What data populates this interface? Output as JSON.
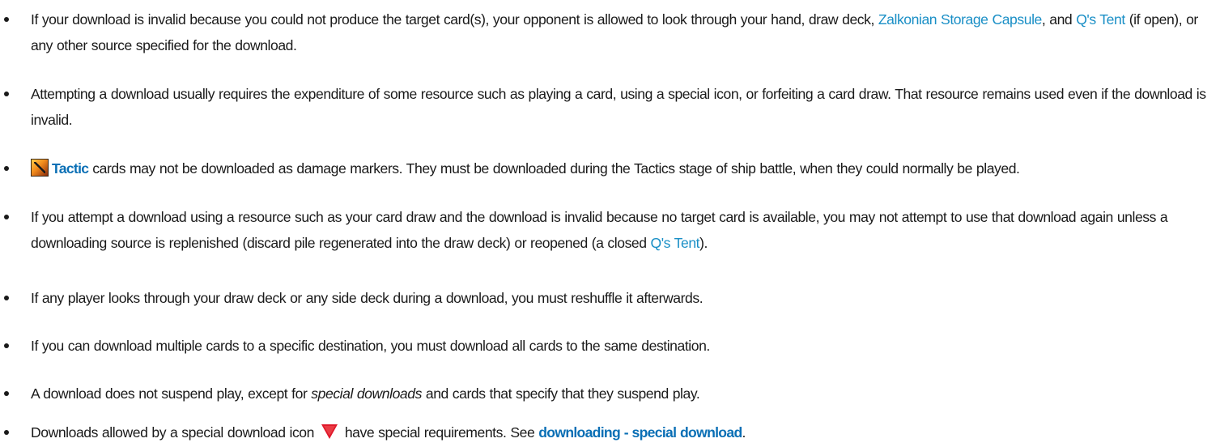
{
  "items": [
    {
      "t1": "If your download is invalid because you could not produce the target card(s), your opponent is allowed to look through your hand, draw deck, ",
      "link1": "Zalkonian Storage Capsule",
      "t2": ", and ",
      "link2": "Q's Tent",
      "t3": " (if open), or any other source specified for the download."
    },
    {
      "t1": "Attempting a download usually requires the expenditure of some resource such as playing a card, using a special icon, or forfeiting a card draw. That resource remains used even if the download is invalid."
    },
    {
      "icon": "tactic-icon",
      "link1": "Tactic",
      "t1": " cards may not be downloaded as damage markers. They must be downloaded during the Tactics stage of ship battle, when they could normally be played."
    },
    {
      "t1": "If you attempt a download using a resource such as your card draw and the download is invalid because no target card is available, you may not attempt to use that download again unless a downloading source is replenished (discard pile regenerated into the draw deck) or reopened (a closed ",
      "link1": "Q's Tent",
      "t2": ")."
    },
    {
      "t1": "If any player looks through your draw deck or any side deck during a download, you must reshuffle it afterwards."
    },
    {
      "t1": "If you can download multiple cards to a specific destination, you must download all cards to the same destination."
    },
    {
      "t1": "A download does not suspend play, except for ",
      "em": "special downloads",
      "t2": " and cards that specify that they suspend play."
    },
    {
      "t1": "Downloads allowed by a special download icon ",
      "icon": "special-download-icon",
      "t2": " have special requirements. See ",
      "link1": "downloading - special download",
      "t3": "."
    }
  ],
  "colors": {
    "text": "#1a1a1a",
    "link": "#1a8fc6",
    "link_bold": "#0a6fb5",
    "special_icon": "#e0192b"
  }
}
